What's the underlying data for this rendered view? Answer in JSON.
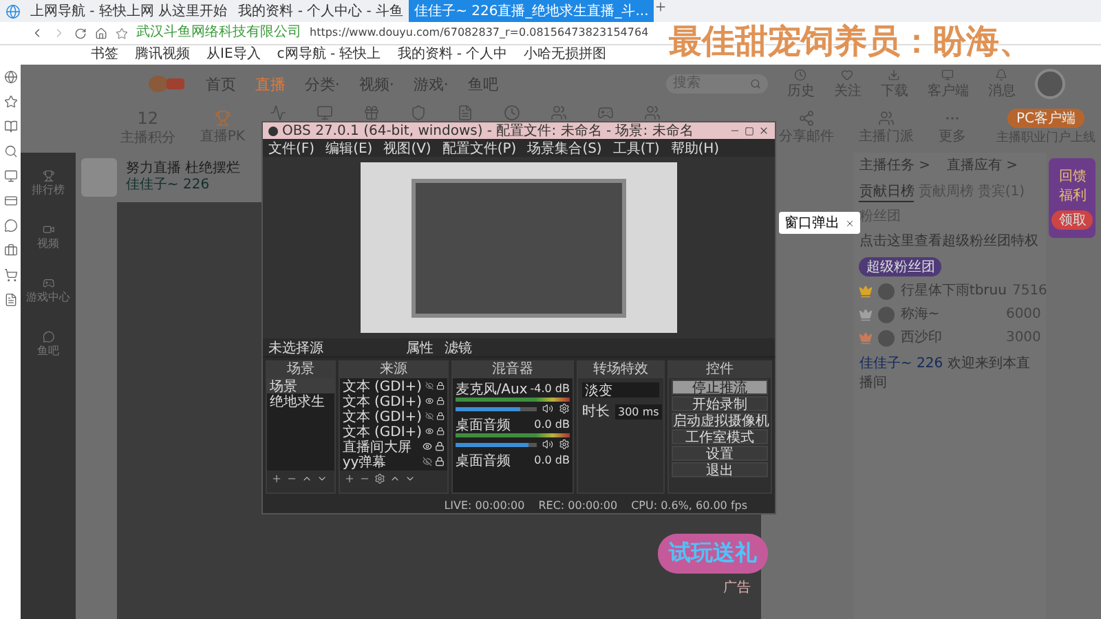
{
  "browser": {
    "tabs": [
      {
        "title": "上网导航 - 轻快上网 从这里开始",
        "selected": false
      },
      {
        "title": "我的资料 - 个人中心 - 斗鱼",
        "selected": false
      },
      {
        "title": "佳佳子~ 226直播_绝地求生直播_斗...",
        "selected": true
      }
    ],
    "site_name": "武汉斗鱼网络科技有限公司",
    "url": "https://www.douyu.com/67082837_r=0.08156473823154764",
    "bookmarks": [
      "书签",
      "腾讯视频",
      "从IE导入",
      "c网导航 - 轻快上",
      "我的资料 - 个人中",
      "小哈无损拼图"
    ]
  },
  "overlay_caption": "最佳甜宠饲养员：盼海、",
  "site": {
    "nav": [
      {
        "label": "首页",
        "selected": false
      },
      {
        "label": "直播",
        "selected": true
      },
      {
        "label": "分类·",
        "selected": false
      },
      {
        "label": "视频·",
        "selected": false
      },
      {
        "label": "游戏·",
        "selected": false
      },
      {
        "label": "鱼吧",
        "selected": false
      }
    ],
    "search": {
      "placeholder": "搜索"
    },
    "header_links": [
      "历史",
      "关注",
      "下载",
      "客户端",
      "消息"
    ],
    "score": {
      "value": "12",
      "label": "主播积分"
    },
    "left_tools": [
      "直播PK"
    ],
    "right_tools": [
      "分享邮件",
      "主播门派",
      "更多"
    ],
    "client_button": "PC客户端",
    "client_note": "主播职业门户上线",
    "sidebar": [
      "排行榜",
      "视频",
      "游戏中心",
      "鱼吧"
    ],
    "streamer": {
      "title": "努力直播 杜绝摆烂",
      "name": "佳佳子~ 226"
    },
    "popup": "窗口弹出",
    "chat": {
      "links": [
        "主播任务 >",
        "直播应有 >"
      ],
      "rank_tabs": [
        {
          "label": "贡献日榜",
          "selected": true
        },
        {
          "label": "贡献周榜",
          "selected": false
        },
        {
          "label": "贵宾(1)",
          "selected": false
        },
        {
          "label": "粉丝团",
          "selected": false
        }
      ],
      "notice": "点击这里查看超级粉丝团特权",
      "notice_button": "超级粉丝团",
      "ranks": [
        {
          "name": "行星体下雨tbruu",
          "score": "7516",
          "color": "#d8a52a"
        },
        {
          "name": "称海~",
          "score": "6000",
          "color": "#a0a0a0"
        },
        {
          "name": "西沙印",
          "score": "3000",
          "color": "#c77b5a"
        }
      ],
      "welcome_user": "佳佳子~ 226",
      "welcome_text": "欢迎来到本直播间"
    },
    "ads": {
      "banner": "回馈福利",
      "banner_button": "领取",
      "promo": "试玩送礼",
      "ad_label": "广告"
    }
  },
  "obs": {
    "title": "OBS 27.0.1 (64-bit, windows) - 配置文件: 未命名 - 场景: 未命名",
    "menu": [
      "文件(F)",
      "编辑(E)",
      "视图(V)",
      "配置文件(P)",
      "场景集合(S)",
      "工具(T)",
      "帮助(H)"
    ],
    "no_source": "未选择源",
    "source_buttons": [
      "属性",
      "滤镜"
    ],
    "panel_titles": [
      "场景",
      "来源",
      "混音器",
      "转场特效",
      "控件"
    ],
    "scenes": [
      {
        "name": "场景",
        "selected": true
      },
      {
        "name": "绝地求生",
        "selected": false
      }
    ],
    "sources": [
      {
        "name": "文本 (GDI+)",
        "visible": false,
        "locked": true
      },
      {
        "name": "文本 (GDI+)",
        "visible": true,
        "locked": true
      },
      {
        "name": "文本 (GDI+)",
        "visible": false,
        "locked": true
      },
      {
        "name": "文本 (GDI+)",
        "visible": true,
        "locked": true
      },
      {
        "name": "直播间大屏",
        "visible": true,
        "locked": true
      },
      {
        "name": "yy弹幕",
        "visible": false,
        "locked": true
      }
    ],
    "mixer": [
      {
        "name": "麦克风/Aux",
        "reading": "-4.0 dB",
        "level": 0.8
      },
      {
        "name": "桌面音频",
        "reading": "0.0 dB",
        "level": 0.9
      },
      {
        "name": "桌面音频",
        "reading": "0.0 dB"
      }
    ],
    "transition": {
      "value": "淡变",
      "duration_label": "时长",
      "duration": "300 ms"
    },
    "controls": [
      {
        "label": "停止推流",
        "active": true
      },
      {
        "label": "开始录制",
        "active": false
      },
      {
        "label": "启动虚拟摄像机",
        "active": false
      },
      {
        "label": "工作室模式",
        "active": false
      },
      {
        "label": "设置",
        "active": false
      },
      {
        "label": "退出",
        "active": false
      }
    ],
    "status": {
      "live": "LIVE: 00:00:00",
      "rec": "REC: 00:00:00",
      "cpu": "CPU: 0.6%, 60.00 fps"
    }
  }
}
